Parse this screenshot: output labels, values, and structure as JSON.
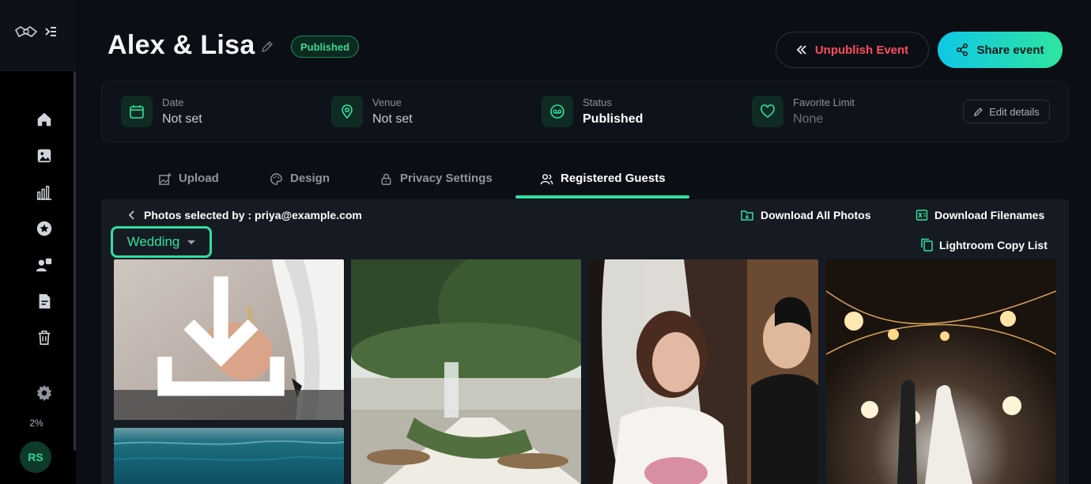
{
  "sidebar": {
    "storage_percent": "2%",
    "avatar_initials": "RS"
  },
  "header": {
    "title": "Alex & Lisa",
    "status_badge": "Published",
    "unpublish_label": "Unpublish Event",
    "share_label": "Share event"
  },
  "info": {
    "date": {
      "label": "Date",
      "value": "Not set"
    },
    "venue": {
      "label": "Venue",
      "value": "Not set"
    },
    "status": {
      "label": "Status",
      "value": "Published"
    },
    "favorite": {
      "label": "Favorite Limit",
      "value": "None"
    },
    "edit_label": "Edit details"
  },
  "tabs": [
    {
      "label": "Upload"
    },
    {
      "label": "Design"
    },
    {
      "label": "Privacy Settings"
    },
    {
      "label": "Registered Guests"
    }
  ],
  "panel": {
    "selected_by": "Photos selected by : priya@example.com",
    "download_all": "Download All Photos",
    "download_filenames": "Download Filenames",
    "lightroom": "Lightroom Copy List",
    "album_selected": "Wedding"
  },
  "colors": {
    "accent": "#2fe1a0",
    "danger": "#ff4d5e",
    "share_gradient_start": "#0fc7e6",
    "share_gradient_end": "#2fe59f"
  }
}
